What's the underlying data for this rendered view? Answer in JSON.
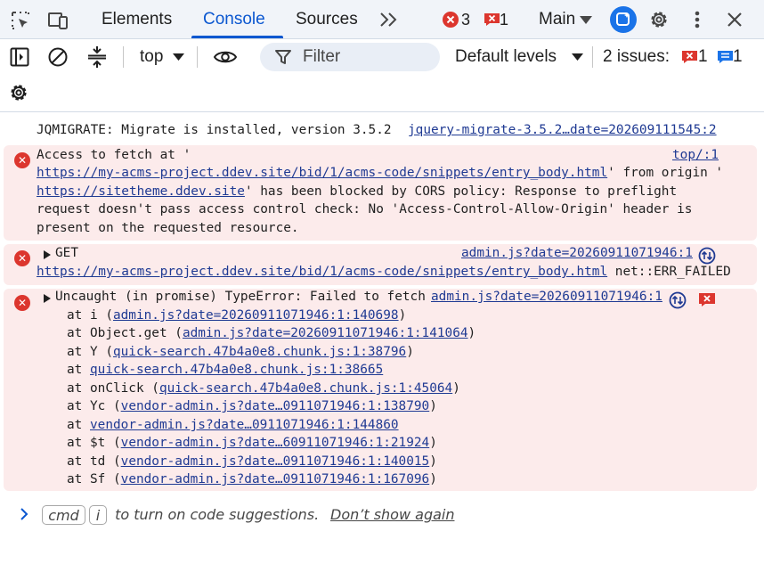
{
  "tabs": {
    "items": [
      "Elements",
      "Console",
      "Sources"
    ],
    "active": "Console",
    "more_icon": "chevron-double-right-icon"
  },
  "status": {
    "error_count": "3",
    "issue_count": "1",
    "context": "Main"
  },
  "toolbar": {
    "context_select": "top",
    "filter_placeholder": "Filter",
    "levels": "Default levels",
    "issues_label": "2 issues:",
    "issues_errors": "1",
    "issues_info": "1"
  },
  "messages": {
    "m1": {
      "text": "JQMIGRATE: Migrate is installed, version 3.5.2",
      "source": "jquery-migrate-3.5.2…date=202609111545:2"
    },
    "m2": {
      "source": "top/:1",
      "l1_text": "Access to fetch at '",
      "l2_link": "https://my-acms-project.ddev.site/bid/1/acms-code/snippets/entry_body.html",
      "l2_text": "' from origin '",
      "l3_link": "https://sitetheme.ddev.site",
      "l3_text": "' has been blocked by CORS policy: Response to preflight",
      "l4_text": "request doesn't pass access control check: No 'Access-Control-Allow-Origin' header is",
      "l5_text": "present on the requested resource."
    },
    "m3": {
      "method": "GET",
      "source": "admin.js?date=20260911071946:1",
      "url": "https://my-acms-project.ddev.site/bid/1/acms-code/snippets/entry_body.html",
      "status": " net::ERR_FAILED"
    },
    "m4": {
      "text": "Uncaught (in promise) TypeError: Failed to fetch",
      "source": "admin.js?date=20260911071946:1",
      "stack": [
        {
          "pre": "at i (",
          "link": "admin.js?date=20260911071946:1:140698",
          "post": ")"
        },
        {
          "pre": "at Object.get (",
          "link": "admin.js?date=20260911071946:1:141064",
          "post": ")"
        },
        {
          "pre": "at Y (",
          "link": "quick-search.47b4a0e8.chunk.js:1:38796",
          "post": ")"
        },
        {
          "pre": "at ",
          "link": "quick-search.47b4a0e8.chunk.js:1:38665",
          "post": ""
        },
        {
          "pre": "at onClick (",
          "link": "quick-search.47b4a0e8.chunk.js:1:45064",
          "post": ")"
        },
        {
          "pre": "at Yc (",
          "link": "vendor-admin.js?date…0911071946:1:138790",
          "post": ")"
        },
        {
          "pre": "at ",
          "link": "vendor-admin.js?date…0911071946:1:144860",
          "post": ""
        },
        {
          "pre": "at $t (",
          "link": "vendor-admin.js?date…60911071946:1:21924",
          "post": ")"
        },
        {
          "pre": "at td (",
          "link": "vendor-admin.js?date…0911071946:1:140015",
          "post": ")"
        },
        {
          "pre": "at Sf (",
          "link": "vendor-admin.js?date…0911071946:1:167096",
          "post": ")"
        }
      ]
    }
  },
  "prompt": {
    "key_badge": "cmd",
    "key_badge2": "i",
    "hint": " to turn on code suggestions.",
    "dismiss": "Don’t show again"
  },
  "colors": {
    "accent": "#0b57d0",
    "error": "#dc362e",
    "error_bg": "#fcebeb",
    "link": "#1f3a93"
  }
}
